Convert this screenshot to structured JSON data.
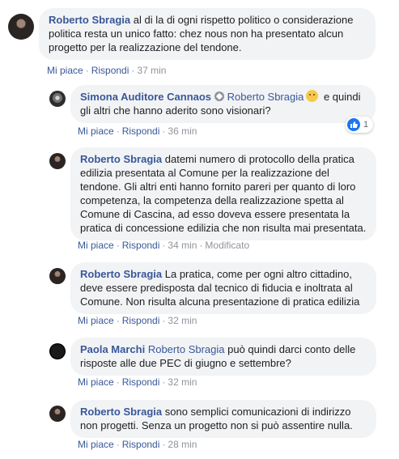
{
  "comments": [
    {
      "author": "Roberto Sbragia",
      "text": "al di la di ogni rispetto politico o considerazione politica resta un unico fatto: chez nous non ha presentato alcun progetto per la realizzazione del tendone.",
      "like": "Mi piace",
      "reply": "Rispondi",
      "time": "37 min"
    }
  ],
  "replies": [
    {
      "author": "Simona Auditore Cannaos",
      "mention": "Roberto Sbragia",
      "text": "e quindi gli altri che hanno aderito sono visionari?",
      "like": "Mi piace",
      "reply": "Rispondi",
      "time": "36 min",
      "reaction_count": "1",
      "reaction_icon": "like-icon"
    },
    {
      "author": "Roberto Sbragia",
      "text": "datemi numero di protocollo della pratica edilizia presentata al Comune per la realizzazione del tendone. Gli altri enti hanno fornito pareri per quanto di loro competenza, la competenza della realizzazione spetta al Comune di Cascina, ad esso doveva essere presentata la pratica di concessione edilizia che non risulta mai presentata.",
      "like": "Mi piace",
      "reply": "Rispondi",
      "time": "34 min",
      "edited": "Modificato"
    },
    {
      "author": "Roberto Sbragia",
      "text": "La pratica, come per ogni altro cittadino, deve essere predisposta dal tecnico di fiducia e inoltrata al Comune. Non risulta alcuna presentazione di pratica edilizia",
      "like": "Mi piace",
      "reply": "Rispondi",
      "time": "32 min"
    },
    {
      "author": "Paola Marchi",
      "mention": "Roberto Sbragia",
      "text": "può quindi darci conto delle risposte alle due PEC di giugno e settembre?",
      "like": "Mi piace",
      "reply": "Rispondi",
      "time": "32 min"
    },
    {
      "author": "Roberto Sbragia",
      "text": "sono semplici comunicazioni di indirizzo non progetti. Senza un progetto non si può assentire nulla.",
      "like": "Mi piace",
      "reply": "Rispondi",
      "time": "28 min"
    }
  ]
}
